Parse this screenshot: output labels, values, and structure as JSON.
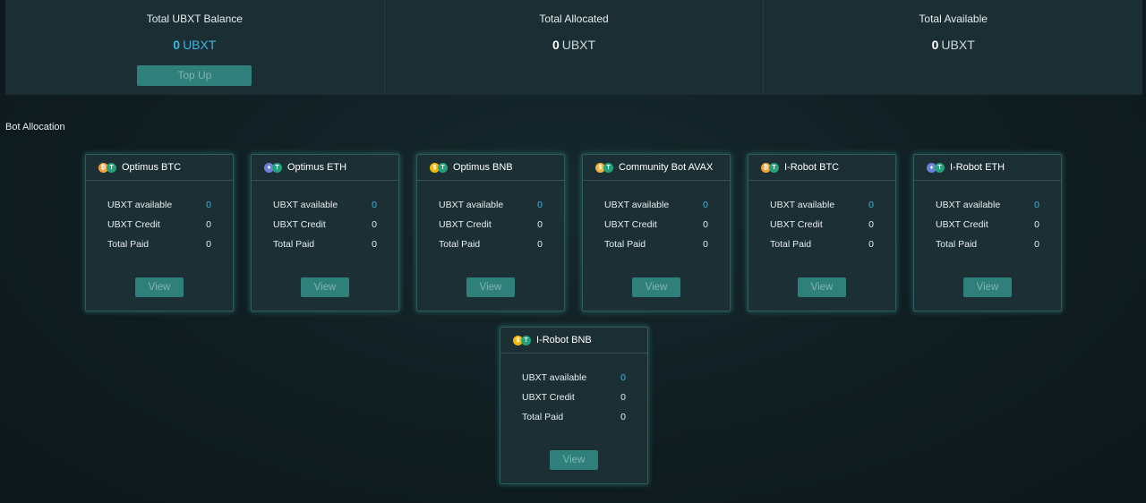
{
  "summary": {
    "balance": {
      "title": "Total UBXT Balance",
      "value": "0",
      "unit": "UBXT",
      "button": "Top Up"
    },
    "allocated": {
      "title": "Total Allocated",
      "value": "0",
      "unit": "UBXT"
    },
    "available": {
      "title": "Total Available",
      "value": "0",
      "unit": "UBXT"
    }
  },
  "section_title": "Bot Allocation",
  "labels": {
    "available": "UBXT available",
    "credit": "UBXT Credit",
    "paid": "Total Paid",
    "view": "View"
  },
  "bots": [
    {
      "name": "Optimus BTC",
      "coins": [
        "btc",
        "usdt"
      ],
      "available": "0",
      "credit": "0",
      "paid": "0"
    },
    {
      "name": "Optimus ETH",
      "coins": [
        "eth",
        "usdt"
      ],
      "available": "0",
      "credit": "0",
      "paid": "0"
    },
    {
      "name": "Optimus BNB",
      "coins": [
        "bnb",
        "usdt"
      ],
      "available": "0",
      "credit": "0",
      "paid": "0"
    },
    {
      "name": "Community Bot AVAX",
      "coins": [
        "avax",
        "usdt"
      ],
      "available": "0",
      "credit": "0",
      "paid": "0"
    },
    {
      "name": "I-Robot BTC",
      "coins": [
        "btc",
        "usdt"
      ],
      "available": "0",
      "credit": "0",
      "paid": "0"
    },
    {
      "name": "I-Robot ETH",
      "coins": [
        "eth",
        "usdt"
      ],
      "available": "0",
      "credit": "0",
      "paid": "0"
    },
    {
      "name": "I-Robot BNB",
      "coins": [
        "bnb",
        "usdt"
      ],
      "available": "0",
      "credit": "0",
      "paid": "0"
    }
  ],
  "colors": {
    "accent": "#39b6e8",
    "button": "#2f7f7a",
    "card": "#1c2f34"
  }
}
